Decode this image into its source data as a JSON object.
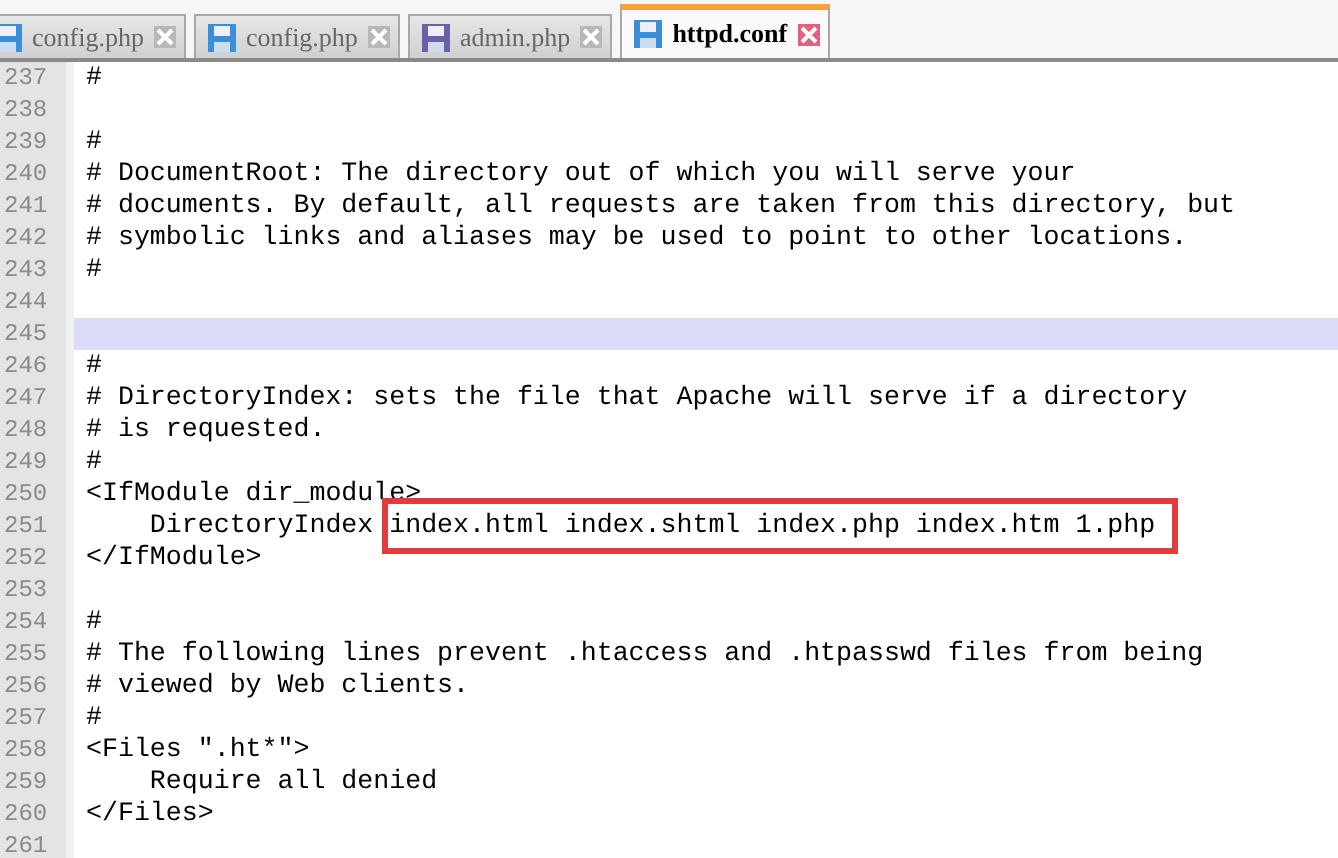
{
  "tabs": [
    {
      "label": "config.php",
      "selected": false,
      "color": "#3a8fd8"
    },
    {
      "label": "config.php",
      "selected": false,
      "color": "#3a8fd8"
    },
    {
      "label": "admin.php",
      "selected": false,
      "color": "#6a5fa8"
    },
    {
      "label": "httpd.conf",
      "selected": true,
      "color": "#3a8fd8"
    }
  ],
  "lines": [
    {
      "number": "237",
      "text": "#",
      "current": false
    },
    {
      "number": "238",
      "current": false
    },
    {
      "number": "239",
      "text": "#",
      "current": false
    },
    {
      "number": "240",
      "text": "# DocumentRoot: The directory out of which you will serve your",
      "current": false
    },
    {
      "number": "241",
      "text": "# documents. By default, all requests are taken from this directory, but",
      "current": false
    },
    {
      "number": "242",
      "text": "# symbolic links and aliases may be used to point to other locations.",
      "current": false
    },
    {
      "number": "243",
      "text": "#",
      "current": false
    },
    {
      "number": "244",
      "current": false
    },
    {
      "number": "245",
      "current": true
    },
    {
      "number": "246",
      "text": "#",
      "current": false
    },
    {
      "number": "247",
      "text": "# DirectoryIndex: sets the file that Apache will serve if a directory",
      "current": false
    },
    {
      "number": "248",
      "text": "# is requested.",
      "current": false
    },
    {
      "number": "249",
      "text": "#",
      "current": false
    },
    {
      "number": "250",
      "text": "<IfModule dir_module>",
      "current": false
    },
    {
      "number": "251",
      "text": "    DirectoryIndex ",
      "annotation": "index.html index.shtml index.php index.htm 1.php",
      "current": false
    },
    {
      "number": "252",
      "text": "</IfModule>",
      "current": false
    },
    {
      "number": "253",
      "current": false
    },
    {
      "number": "254",
      "text": "#",
      "current": false
    },
    {
      "number": "255",
      "text": "# The following lines prevent .htaccess and .htpasswd files from being",
      "current": false
    },
    {
      "number": "256",
      "text": "# viewed by Web clients.",
      "current": false
    },
    {
      "number": "257",
      "text": "#",
      "current": false
    },
    {
      "number": "258",
      "text": "<Files \".ht*\">",
      "current": false
    },
    {
      "number": "259",
      "text": "    Require all denied",
      "current": false
    },
    {
      "number": "260",
      "text": "</Files>",
      "current": false
    },
    {
      "number": "261",
      "current": false
    }
  ]
}
